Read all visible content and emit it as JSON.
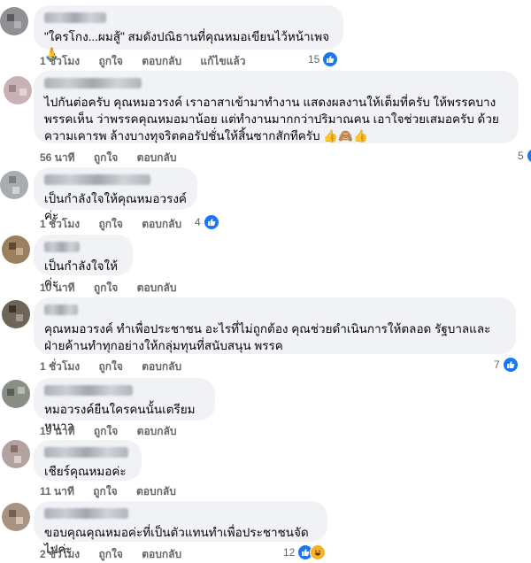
{
  "comments": [
    {
      "text": "\"ใครโกง...ผมสู้\" สมดังปณิธานที่คุณหมอเขียนไว้หน้าเพจ 🙏",
      "time": "1 ชั่วโมง",
      "like": "ถูกใจ",
      "reply": "ตอบกลับ",
      "edited": "แก้ไขแล้ว",
      "reaction_count": "15",
      "reaction_icons": [
        "like-icon"
      ]
    },
    {
      "text": "ไปกันต่อครับ คุณหมอวรงค์ เราอาสาเข้ามาทำงาน แสดงผลงานให้เต็มที่ครับ ให้พรรคบางพรรคเห็น ว่าพรรคคุณหมอมาน้อย แต่ทำงานมากกว่าปริมาณคน เอาใจช่วยเสมอครับ ด้วยความเคารพ ล้างบางทุจริตคอรัปชั่นให้สิ้นซากสักทีครับ 👍🙈👍",
      "time": "56 นาที",
      "like": "ถูกใจ",
      "reply": "ตอบกลับ",
      "reaction_count": "5",
      "reaction_icons": [
        "like-icon"
      ]
    },
    {
      "text": "เป็นกำลังใจให้คุณหมอวรงค์ค่ะ",
      "time": "1 ชั่วโมง",
      "like": "ถูกใจ",
      "reply": "ตอบกลับ",
      "reaction_count": "4",
      "reaction_icons": [
        "like-icon"
      ]
    },
    {
      "text": "เป็นกำลังใจให้ค่ะ",
      "time": "10 นาที",
      "like": "ถูกใจ",
      "reply": "ตอบกลับ"
    },
    {
      "text": "คุณหมอวรงค์ ทำเพื่อประชาชน อะไรที่ไม่ถูกต้อง คุณช่วยดำเนินการให้ตลอด รัฐบาลและฝ่ายค้านทำทุกอย่างให้กลุ่มทุนที่สนับสนุน พรรค",
      "time": "1 ชั่วโมง",
      "like": "ถูกใจ",
      "reply": "ตอบกลับ",
      "reaction_count": "7",
      "reaction_icons": [
        "like-icon"
      ]
    },
    {
      "text": "หมอวรงค์ยืนใครคนนั้นเตรียมหนาว",
      "time": "19 นาที",
      "like": "ถูกใจ",
      "reply": "ตอบกลับ"
    },
    {
      "text": "เชียร์คุณหมอค่ะ",
      "time": "11 นาที",
      "like": "ถูกใจ",
      "reply": "ตอบกลับ"
    },
    {
      "text": "ขอบคุณคุณหมอค่ะที่เป็นตัวแทนทำเพื่อประชาชนจัดไปค่ะ",
      "time": "2 ชั่วโมง",
      "like": "ถูกใจ",
      "reply": "ตอบกลับ",
      "reaction_count": "12",
      "reaction_icons": [
        "like-icon",
        "haha-icon"
      ]
    }
  ],
  "colors": {
    "bubble": "#f0f2f5",
    "meta": "#65676b",
    "like": "#1877f2"
  }
}
